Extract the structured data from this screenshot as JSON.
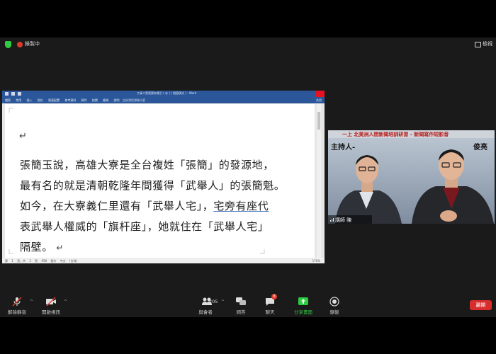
{
  "status": {
    "recording_label": "錄製中",
    "view_label": "檢視"
  },
  "word": {
    "doc_title": "丁員二黑東實有電引 ( 存 ) [ 相容模式 ] - Word",
    "tabs": "檔案 常用 插入 設計 版面配置 參考資料 郵件 校閱 檢視 說明",
    "search": "告訴我您想做什麼",
    "share": "共用",
    "status_text": "第 1 頁，共 3 頁   958 個字   中文 (台灣)",
    "zoom": "170%",
    "lines": [
      "張簡玉說，高雄大寮是全台複姓「張簡」的發源地，",
      "最有名的就是清朝乾隆年間獲得「武舉人」的張簡魁。",
      "如今，在大寮義仁里還有「武舉人宅」，",
      "宅旁有座代",
      "表武舉人權威的「旗杆座」，她就住在「武舉人宅」",
      "隔壁。"
    ]
  },
  "video": {
    "banner": "一上 北美洲人間新聞培訓研習 - 新聞寫作短影音",
    "host_label": "主持人-",
    "name2": "俊亮",
    "participant_label": "講師 陳"
  },
  "toolbar": {
    "mute": "解除靜音",
    "video": "開啟視訊",
    "participants_count": "205",
    "participants": "與會者",
    "qa": "問答",
    "chat": "聊天",
    "chat_badge": "8",
    "share": "分享畫面",
    "record": "錄製",
    "end": "離開"
  },
  "colors": {
    "word_blue": "#2b579a",
    "share_green": "#2ecc40",
    "end_red": "#d92d2d"
  }
}
